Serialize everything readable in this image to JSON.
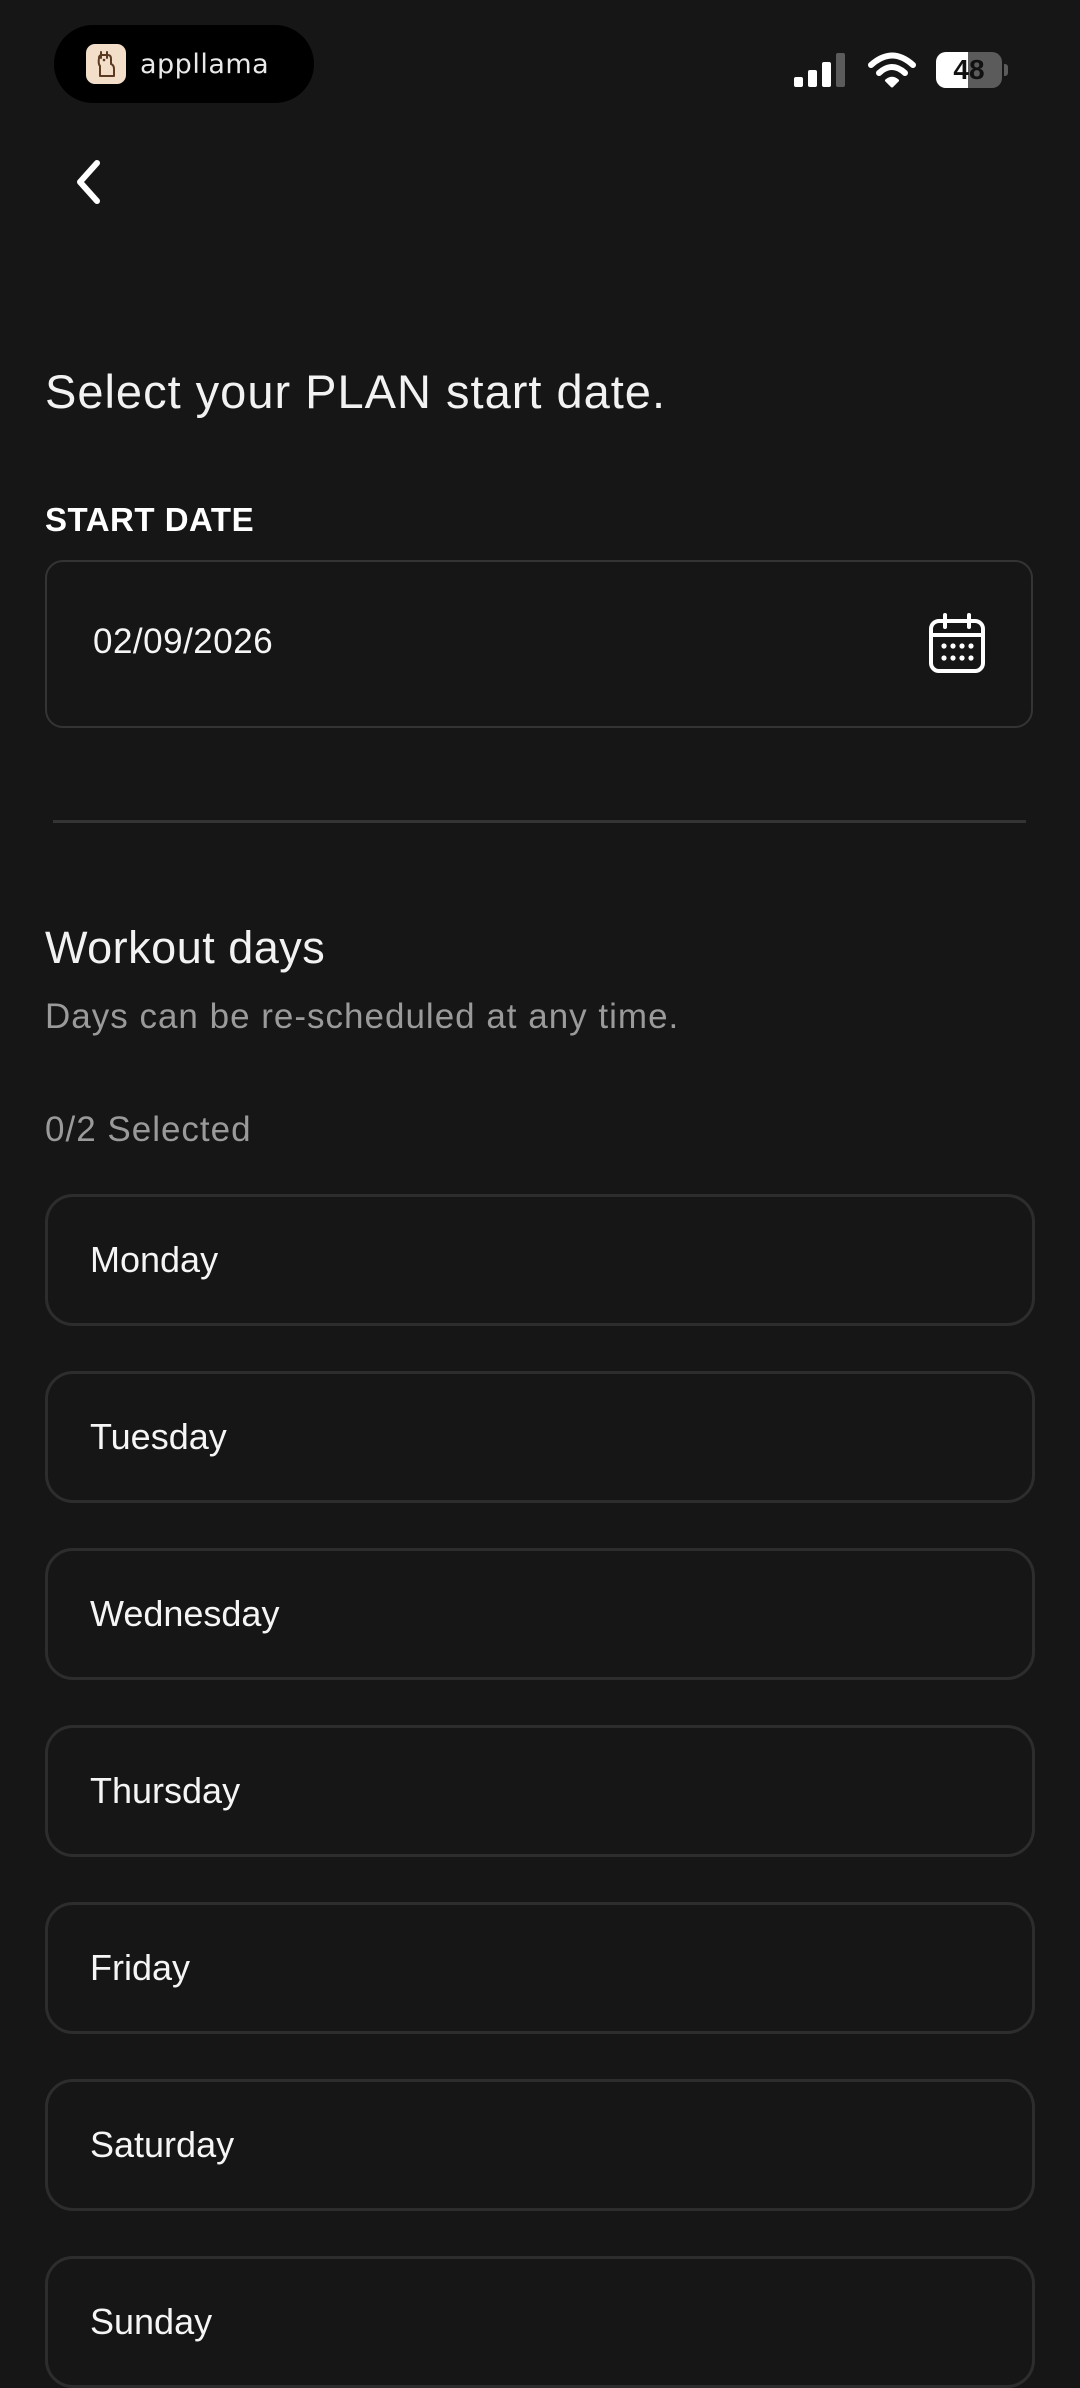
{
  "status_bar": {
    "app_name": "appllama",
    "battery": "48",
    "battery_level": 0.48,
    "icons": [
      "signal-icon",
      "wifi-icon",
      "battery-icon"
    ]
  },
  "nav": {
    "back_icon": "chevron-left-icon"
  },
  "page": {
    "title": "Select your PLAN start date."
  },
  "start_date": {
    "label": "START DATE",
    "value": "02/09/2026",
    "icon": "calendar-icon"
  },
  "workout_days": {
    "title": "Workout days",
    "subtitle": "Days can be re-scheduled at any time.",
    "selected_count": "0/2 Selected",
    "days": [
      {
        "label": "Monday",
        "selected": false
      },
      {
        "label": "Tuesday",
        "selected": false
      },
      {
        "label": "Wednesday",
        "selected": false
      },
      {
        "label": "Thursday",
        "selected": false
      },
      {
        "label": "Friday",
        "selected": false
      },
      {
        "label": "Saturday",
        "selected": false
      },
      {
        "label": "Sunday",
        "selected": false
      }
    ]
  },
  "colors": {
    "background": "#161616",
    "border": "#2d2d2d",
    "text_primary": "#f5f5f5",
    "text_secondary": "#9a9a9a"
  }
}
